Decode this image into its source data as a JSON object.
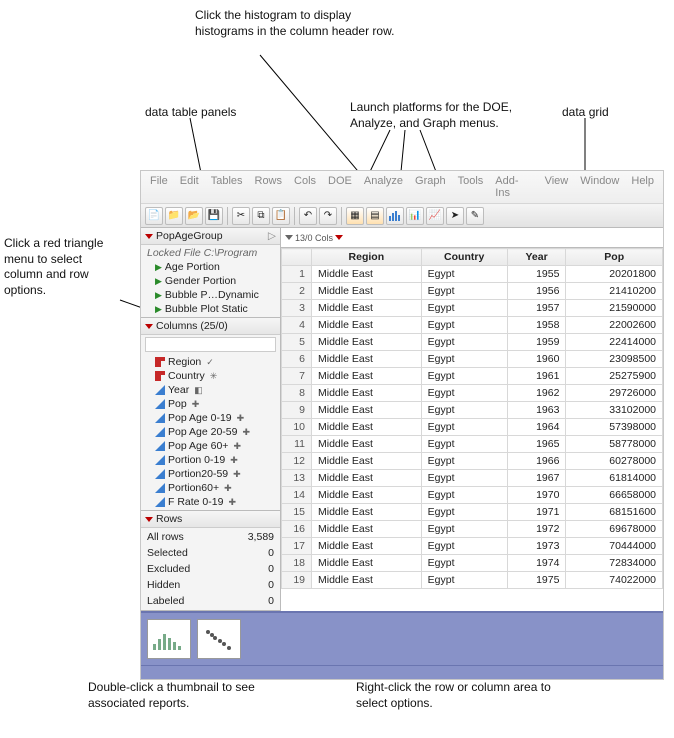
{
  "annotations": {
    "histogram": "Click the histogram to display histograms in the column header row.",
    "panels": "data table panels",
    "platforms": "Launch platforms for the DOE, Analyze, and Graph menus.",
    "grid": "data grid",
    "redtri": "Click a red triangle menu to select column and row options.",
    "thumbs": "Double-click a thumbnail to see associated reports.",
    "rightclick": "Right-click the row or column area to select options."
  },
  "menu": [
    "File",
    "Edit",
    "Tables",
    "Rows",
    "Cols",
    "DOE",
    "Analyze",
    "Graph",
    "Tools",
    "Add-Ins",
    "View",
    "Window",
    "Help"
  ],
  "main_panel": {
    "title": "PopAgeGroup",
    "locked": "Locked File  C:\\Program",
    "scripts": [
      "Age Portion",
      "Gender Portion",
      "Bubble P…Dynamic",
      "Bubble Plot Static"
    ]
  },
  "columns_panel": {
    "title": "Columns (25/0)",
    "items": [
      {
        "name": "Region",
        "icon": "red",
        "badge": "✓"
      },
      {
        "name": "Country",
        "icon": "red",
        "badge": "✳"
      },
      {
        "name": "Year",
        "icon": "blue",
        "badge": "◧"
      },
      {
        "name": "Pop",
        "icon": "blue",
        "badge": "✚"
      },
      {
        "name": "Pop Age 0-19",
        "icon": "blue",
        "badge": "✚"
      },
      {
        "name": "Pop Age 20-59",
        "icon": "blue",
        "badge": "✚"
      },
      {
        "name": "Pop Age 60+",
        "icon": "blue",
        "badge": "✚"
      },
      {
        "name": "Portion 0-19",
        "icon": "blue",
        "badge": "✚"
      },
      {
        "name": "Portion20-59",
        "icon": "blue",
        "badge": "✚"
      },
      {
        "name": "Portion60+",
        "icon": "blue",
        "badge": "✚"
      },
      {
        "name": "F Rate 0-19",
        "icon": "blue",
        "badge": "✚"
      }
    ]
  },
  "rows_panel": {
    "title": "Rows",
    "stats": [
      {
        "label": "All rows",
        "value": "3,589"
      },
      {
        "label": "Selected",
        "value": "0"
      },
      {
        "label": "Excluded",
        "value": "0"
      },
      {
        "label": "Hidden",
        "value": "0"
      },
      {
        "label": "Labeled",
        "value": "0"
      }
    ]
  },
  "grid_corner": "13/0 Cols",
  "grid_headers": [
    "",
    "Region",
    "Country",
    "Year",
    "Pop"
  ],
  "grid_rows": [
    {
      "n": 1,
      "region": "Middle East",
      "country": "Egypt",
      "year": 1955,
      "pop": 20201800
    },
    {
      "n": 2,
      "region": "Middle East",
      "country": "Egypt",
      "year": 1956,
      "pop": 21410200
    },
    {
      "n": 3,
      "region": "Middle East",
      "country": "Egypt",
      "year": 1957,
      "pop": 21590000
    },
    {
      "n": 4,
      "region": "Middle East",
      "country": "Egypt",
      "year": 1958,
      "pop": 22002600
    },
    {
      "n": 5,
      "region": "Middle East",
      "country": "Egypt",
      "year": 1959,
      "pop": 22414000
    },
    {
      "n": 6,
      "region": "Middle East",
      "country": "Egypt",
      "year": 1960,
      "pop": 23098500
    },
    {
      "n": 7,
      "region": "Middle East",
      "country": "Egypt",
      "year": 1961,
      "pop": 25275900
    },
    {
      "n": 8,
      "region": "Middle East",
      "country": "Egypt",
      "year": 1962,
      "pop": 29726000
    },
    {
      "n": 9,
      "region": "Middle East",
      "country": "Egypt",
      "year": 1963,
      "pop": 33102000
    },
    {
      "n": 10,
      "region": "Middle East",
      "country": "Egypt",
      "year": 1964,
      "pop": 57398000
    },
    {
      "n": 11,
      "region": "Middle East",
      "country": "Egypt",
      "year": 1965,
      "pop": 58778000
    },
    {
      "n": 12,
      "region": "Middle East",
      "country": "Egypt",
      "year": 1966,
      "pop": 60278000
    },
    {
      "n": 13,
      "region": "Middle East",
      "country": "Egypt",
      "year": 1967,
      "pop": 61814000
    },
    {
      "n": 14,
      "region": "Middle East",
      "country": "Egypt",
      "year": 1970,
      "pop": 66658000
    },
    {
      "n": 15,
      "region": "Middle East",
      "country": "Egypt",
      "year": 1971,
      "pop": 68151600
    },
    {
      "n": 16,
      "region": "Middle East",
      "country": "Egypt",
      "year": 1972,
      "pop": 69678000
    },
    {
      "n": 17,
      "region": "Middle East",
      "country": "Egypt",
      "year": 1973,
      "pop": 70444000
    },
    {
      "n": 18,
      "region": "Middle East",
      "country": "Egypt",
      "year": 1974,
      "pop": 72834000
    },
    {
      "n": 19,
      "region": "Middle East",
      "country": "Egypt",
      "year": 1975,
      "pop": 74022000
    }
  ]
}
